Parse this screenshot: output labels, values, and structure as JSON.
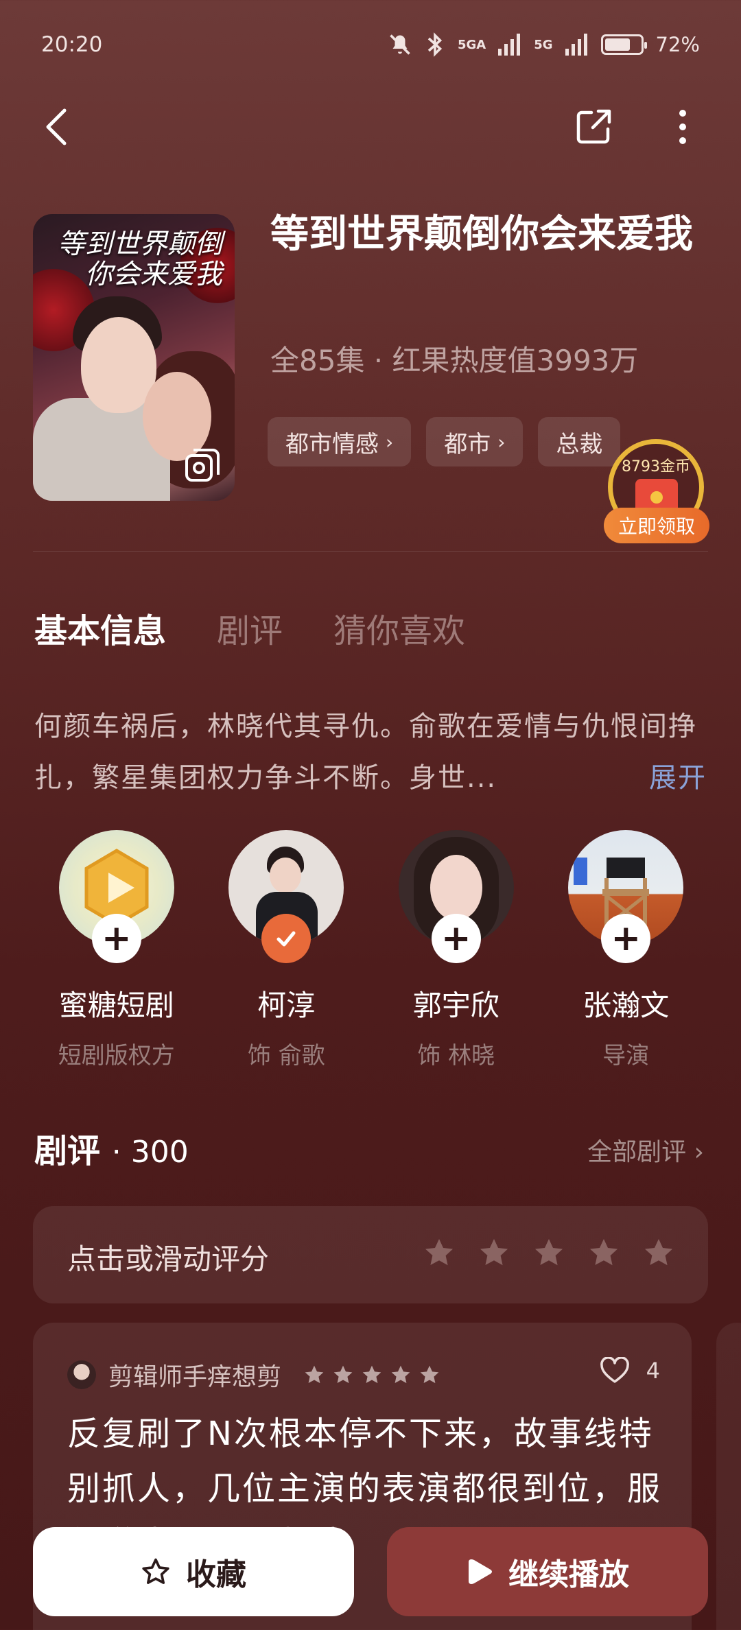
{
  "status_bar": {
    "time": "20:20",
    "network1": "5GA",
    "network2": "5G",
    "battery": "72%",
    "battery_level": 0.72
  },
  "drama": {
    "title": "等到世界颠倒你会来爱我",
    "meta": "全85集 · 红果热度值3993万",
    "tags": [
      "都市情感",
      "都市",
      "总裁"
    ],
    "poster_title_line1": "等到世界颠倒",
    "poster_title_line2": "你会来爱我"
  },
  "coin_widget": {
    "amount": "8793金币",
    "claim": "立即领取"
  },
  "tabs": [
    "基本信息",
    "剧评",
    "猜你喜欢"
  ],
  "description": {
    "text": "何颜车祸后，林晓代其寻仇。俞歌在爱情与仇恨间挣扎，繁星集团权力争斗不断。身世...",
    "expand": "展开"
  },
  "cast": [
    {
      "name": "蜜糖短剧",
      "role": "短剧版权方",
      "followed": false
    },
    {
      "name": "柯淳",
      "role": "饰 俞歌",
      "followed": true
    },
    {
      "name": "郭宇欣",
      "role": "饰 林晓",
      "followed": false
    },
    {
      "name": "张瀚文",
      "role": "导演",
      "followed": false
    }
  ],
  "reviews": {
    "header": "剧评",
    "count": "· 300",
    "all_link": "全部剧评",
    "rate_prompt": "点击或滑动评分",
    "items": [
      {
        "user": "剪辑师手痒想剪",
        "rating": 5,
        "likes": "4",
        "text": "反复刷了N次根本停不下来，故事线特别抓人，几位主演的表演都很到位，服化道也很用心制造"
      }
    ]
  },
  "bottom_bar": {
    "favorite": "收藏",
    "continue": "继续播放"
  },
  "colors": {
    "background": "#5e2a28",
    "accent_orange": "#e86a3a",
    "play_button": "#8d3a38",
    "link_blue": "#8aa2d8"
  }
}
